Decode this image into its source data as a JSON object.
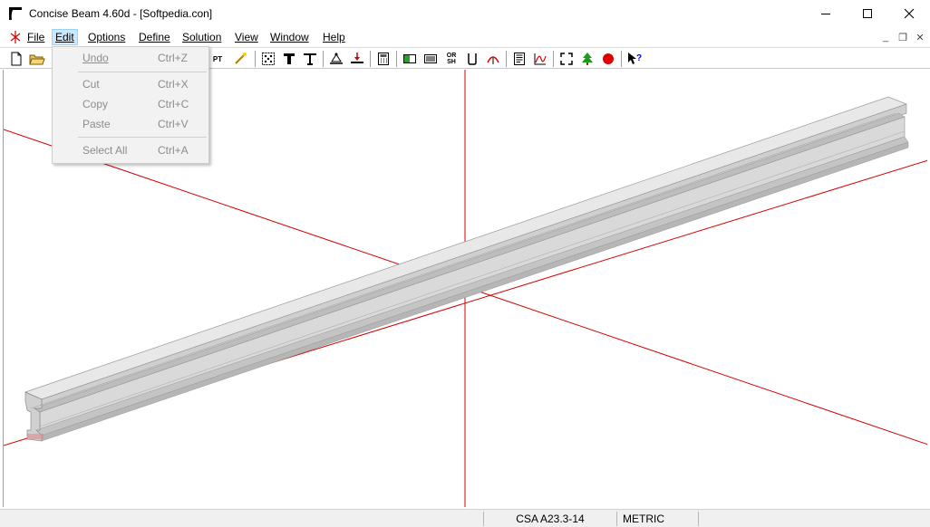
{
  "window": {
    "title": "Concise Beam 4.60d - [Softpedia.con]",
    "minimize_glyph": "—",
    "maximize_glyph": "☐",
    "close_glyph": "✕"
  },
  "menubar": {
    "items": [
      {
        "label": "File"
      },
      {
        "label": "Edit"
      },
      {
        "label": "Options"
      },
      {
        "label": "Define"
      },
      {
        "label": "Solution"
      },
      {
        "label": "View"
      },
      {
        "label": "Window"
      },
      {
        "label": "Help"
      }
    ],
    "active": "Edit",
    "doc_min_glyph": "_",
    "doc_restore_glyph": "❐",
    "doc_close_glyph": "✕"
  },
  "edit_menu": {
    "items": [
      {
        "label": "Undo",
        "shortcut": "Ctrl+Z",
        "enabled": false
      },
      {
        "label": "Cut",
        "shortcut": "Ctrl+X",
        "enabled": false
      },
      {
        "label": "Copy",
        "shortcut": "Ctrl+C",
        "enabled": false
      },
      {
        "label": "Paste",
        "shortcut": "Ctrl+V",
        "enabled": false
      },
      {
        "label": "Select All",
        "shortcut": "Ctrl+A",
        "enabled": false
      }
    ]
  },
  "toolbar": {
    "icons": [
      "new-file-icon",
      "open-folder-icon",
      "pt-icon",
      "wand-icon",
      "section-dots-icon",
      "t-beam-icon",
      "inverted-t-icon",
      "support-icon",
      "load-icon",
      "calculator-icon",
      "shear-icon",
      "moment-icon",
      "or-sh-icon",
      "u-stirrup-icon",
      "deflection-icon",
      "report-icon",
      "graph-icon",
      "expand-icon",
      "tree-icon",
      "record-icon",
      "help-pointer-icon"
    ],
    "labels": {
      "pt": "PT",
      "or_sh": "OR SH"
    }
  },
  "statusbar": {
    "code": "CSA A23.3-14",
    "units": "METRIC"
  },
  "colors": {
    "axis": "#d40000",
    "beam_fill": "#d9d9d9",
    "beam_edge": "#9a9a9a",
    "menu_highlight": "#cce8ff"
  }
}
